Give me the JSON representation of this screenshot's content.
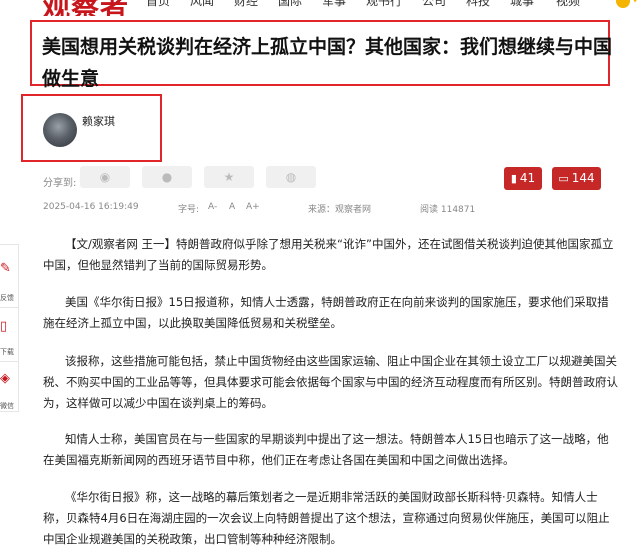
{
  "nav": {
    "logo": "观察者",
    "items": [
      "首页",
      "风闻",
      "财经",
      "国际",
      "军事",
      "观书行",
      "公司",
      "科技",
      "城事",
      "视频"
    ]
  },
  "article": {
    "title": "美国想用关税谈判在经济上孤立中国？其他国家：我们想继续与中国做生意",
    "author": "赖家琪",
    "share_label": "分享到:",
    "bookmark_count": "41",
    "comment_count": "144",
    "date": "2025-04-16 16:19:49",
    "font_size_label": "字号:",
    "font_minus": "A-",
    "font_normal": "A",
    "font_plus": "A+",
    "source": "来源：观察者网",
    "views": "阅读 114871",
    "paragraphs": [
      "【文/观察者网 王一】特朗普政府似乎除了想用关税来“讹诈”中国外，还在试图借关税谈判迫使其他国家孤立中国，但他显然错判了当前的国际贸易形势。",
      "美国《华尔街日报》15日报道称，知情人士透露，特朗普政府正在向前来谈判的国家施压，要求他们采取措施在经济上孤立中国，以此换取美国降低贸易和关税壁垒。",
      "该报称，这些措施可能包括，禁止中国货物经由这些国家运输、阻止中国企业在其领土设立工厂以规避美国关税、不购买中国的工业品等等，但具体要求可能会依据每个国家与中国的经济互动程度而有所区别。特朗普政府认为，这样做可以减少中国在谈判桌上的筹码。",
      "知情人士称，美国官员在与一些国家的早期谈判中提出了这一想法。特朗普本人15日也暗示了这一战略，他在美国福克斯新闻网的西班牙语节目中称，他们正在考虑让各国在美国和中国之间做出选择。",
      "《华尔街日报》称，这一战略的幕后策划者之一是近期非常活跃的美国财政部长斯科特·贝森特。知情人士称，贝森特4月6日在海湖庄园的一次会议上向特朗普提出了这个想法，宣称通过向贸易伙伴施压，美国可以阻止中国企业规避美国的关税政策，出口管制等种种经济限制。"
    ]
  },
  "sidebar": {
    "items": [
      {
        "icon": "feedback-icon",
        "label": "反馈"
      },
      {
        "icon": "download-icon",
        "label": "下载"
      },
      {
        "icon": "wechat-icon",
        "label": "微信"
      }
    ]
  },
  "colors": {
    "brand_red": "#c8161d",
    "highlight_border": "#e0252b",
    "count_button": "#c62828"
  }
}
